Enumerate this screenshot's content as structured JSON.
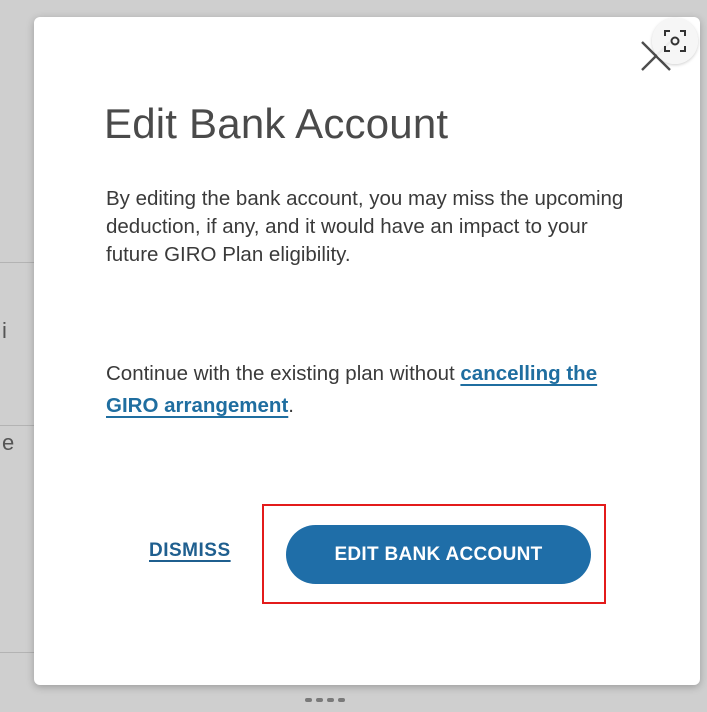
{
  "dialog": {
    "title": "Edit Bank Account",
    "message": "By editing the bank account, you may miss the upcoming deduction, if any, and it would have an impact to your future GIRO Plan eligibility.",
    "continue_prefix": "Continue with the existing plan without ",
    "continue_link": "cancelling the GIRO arrangement",
    "continue_suffix": ".",
    "dismiss_label": "DISMISS",
    "primary_label": "EDIT BANK ACCOUNT",
    "close_icon": "close-icon"
  },
  "overlay": {
    "lens_icon": "screen-search-icon",
    "highlight_color": "#e31b1b"
  },
  "colors": {
    "primary": "#1f6ea8",
    "link": "#1f6ea0",
    "title": "#4a4a4a",
    "text": "#3a3a3a"
  }
}
